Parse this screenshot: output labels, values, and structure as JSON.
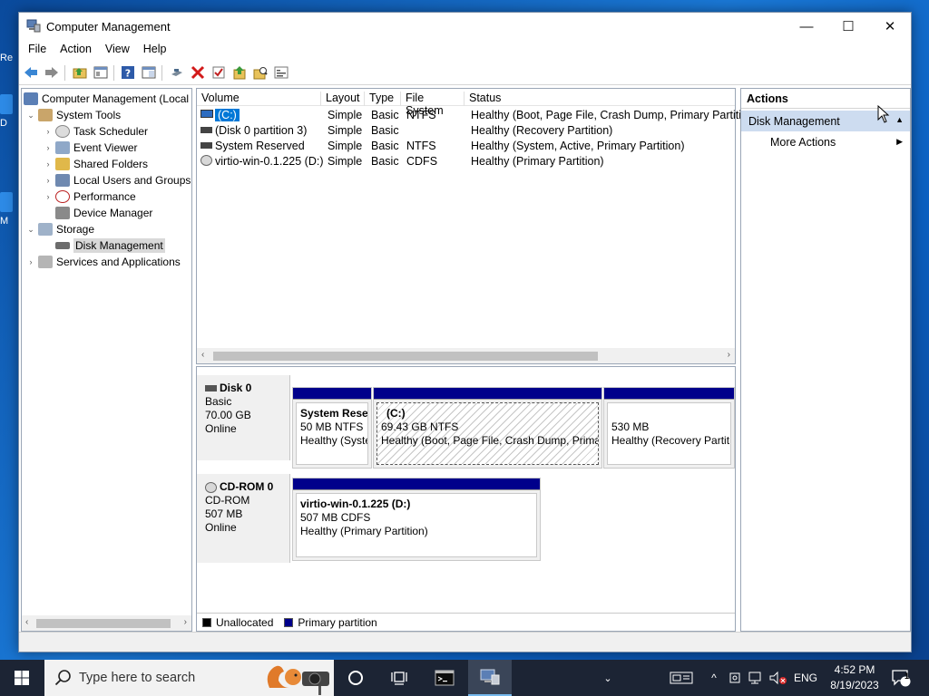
{
  "window": {
    "title": "Computer Management",
    "minimize_glyph": "—",
    "maximize_glyph": "☐",
    "close_glyph": "✕"
  },
  "menu": [
    "File",
    "Action",
    "View",
    "Help"
  ],
  "tree": {
    "root": "Computer Management (Local",
    "system_tools": "System Tools",
    "task_scheduler": "Task Scheduler",
    "event_viewer": "Event Viewer",
    "shared_folders": "Shared Folders",
    "local_users": "Local Users and Groups",
    "performance": "Performance",
    "device_manager": "Device Manager",
    "storage": "Storage",
    "disk_management": "Disk Management",
    "services_apps": "Services and Applications"
  },
  "volume_list": {
    "headers": {
      "volume": "Volume",
      "layout": "Layout",
      "type": "Type",
      "fs": "File System",
      "status": "Status"
    },
    "rows": [
      {
        "volume": "(C:)",
        "layout": "Simple",
        "type": "Basic",
        "fs": "NTFS",
        "status": "Healthy (Boot, Page File, Crash Dump, Primary Partition"
      },
      {
        "volume": "(Disk 0 partition 3)",
        "layout": "Simple",
        "type": "Basic",
        "fs": "",
        "status": "Healthy (Recovery Partition)"
      },
      {
        "volume": "System Reserved",
        "layout": "Simple",
        "type": "Basic",
        "fs": "NTFS",
        "status": "Healthy (System, Active, Primary Partition)"
      },
      {
        "volume": "virtio-win-0.1.225 (D:)",
        "layout": "Simple",
        "type": "Basic",
        "fs": "CDFS",
        "status": "Healthy (Primary Partition)"
      }
    ]
  },
  "disks": {
    "disk0": {
      "name": "Disk 0",
      "type": "Basic",
      "size": "70.00 GB",
      "state": "Online",
      "p1": {
        "name": "System Reser",
        "size": "50 MB NTFS",
        "status": "Healthy (Syste"
      },
      "p2": {
        "name": "(C:)",
        "size": "69.43 GB NTFS",
        "status": "Healthy (Boot, Page File, Crash Dump, Primar"
      },
      "p3": {
        "size": "530 MB",
        "status": "Healthy (Recovery Partit"
      }
    },
    "cdrom0": {
      "name": "CD-ROM 0",
      "type": "CD-ROM",
      "size": "507 MB",
      "state": "Online",
      "p1": {
        "name": "virtio-win-0.1.225  (D:)",
        "size": "507 MB CDFS",
        "status": "Healthy (Primary Partition)"
      }
    }
  },
  "legend": {
    "unallocated": "Unallocated",
    "primary": "Primary partition",
    "unallocated_color": "#000000",
    "primary_color": "#00008b"
  },
  "actions": {
    "title": "Actions",
    "section": "Disk Management",
    "more": "More Actions"
  },
  "taskbar": {
    "search_placeholder": "Type here to search",
    "lang": "ENG",
    "time": "4:52 PM",
    "date": "8/19/2023",
    "notification_count": "1"
  },
  "desktop_letters": [
    "Re",
    "D",
    "M"
  ]
}
